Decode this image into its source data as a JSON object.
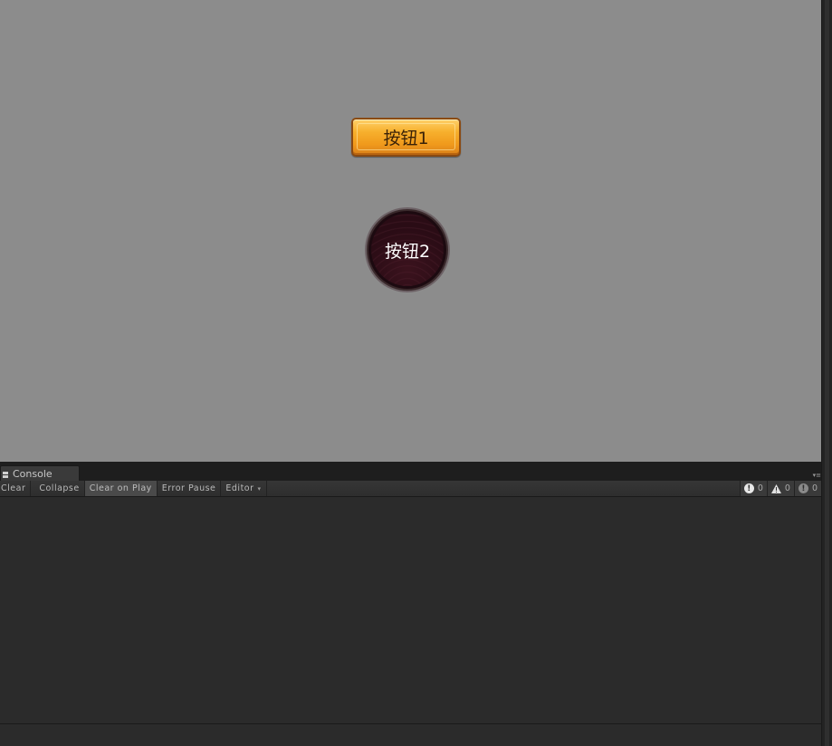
{
  "game_view": {
    "button1_label": "按钮1",
    "button2_label": "按钮2"
  },
  "console": {
    "tab_label": "Console",
    "toolbar": {
      "clear": "Clear",
      "collapse": "Collapse",
      "clear_on_play": "Clear on Play",
      "error_pause": "Error Pause",
      "editor": "Editor"
    },
    "counts": {
      "info": "0",
      "warnings": "0",
      "errors": "0"
    }
  },
  "colors": {
    "game_bg": "#8c8c8c",
    "button1_fill": "#f7b02d",
    "button2_fill": "#2a0b14",
    "console_bg": "#2b2b2b"
  },
  "icons": [
    "console-icon",
    "panel-menu-icon",
    "info-icon",
    "warning-icon",
    "error-icon",
    "dropdown-caret-icon"
  ]
}
